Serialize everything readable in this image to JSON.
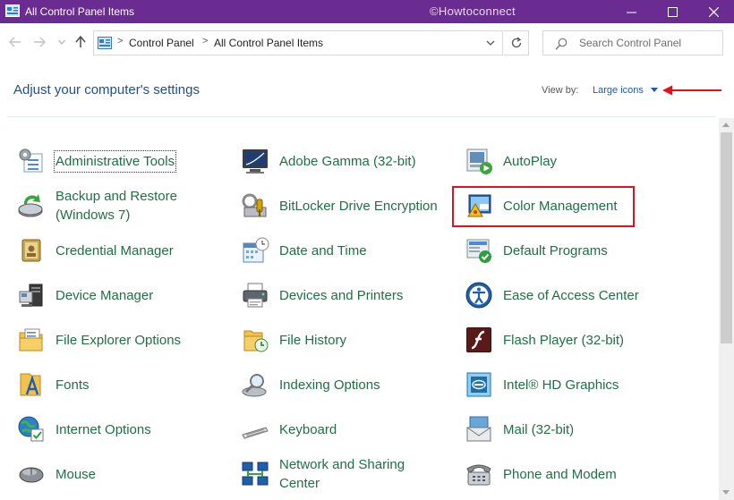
{
  "window": {
    "title": "All Control Panel Items",
    "watermark": "©Howtoconnect",
    "title_color": "#6b2c91"
  },
  "address": {
    "breadcrumbs": [
      "Control Panel",
      "All Control Panel Items"
    ],
    "search_placeholder": "Search Control Panel"
  },
  "header": {
    "heading": "Adjust your computer's settings",
    "view_by_label": "View by:",
    "view_by_value": "Large icons"
  },
  "colors": {
    "link_green": "#1f7044",
    "heading_blue": "#1e4e8c",
    "highlight_red": "#e3101d"
  },
  "items": [
    {
      "label": "Administrative Tools",
      "icon": "administrative-tools-icon"
    },
    {
      "label": "Adobe Gamma (32-bit)",
      "icon": "adobe-gamma-icon"
    },
    {
      "label": "AutoPlay",
      "icon": "autoplay-icon"
    },
    {
      "label": "Backup and Restore\n(Windows 7)",
      "icon": "backup-restore-icon"
    },
    {
      "label": "BitLocker Drive Encryption",
      "icon": "bitlocker-icon"
    },
    {
      "label": "Color Management",
      "icon": "color-management-icon"
    },
    {
      "label": "Credential Manager",
      "icon": "credential-manager-icon"
    },
    {
      "label": "Date and Time",
      "icon": "calendar-clock-icon"
    },
    {
      "label": "Default Programs",
      "icon": "default-programs-icon"
    },
    {
      "label": "Device Manager",
      "icon": "device-manager-icon"
    },
    {
      "label": "Devices and Printers",
      "icon": "printer-icon"
    },
    {
      "label": "Ease of Access Center",
      "icon": "ease-of-access-icon"
    },
    {
      "label": "File Explorer Options",
      "icon": "folder-options-icon"
    },
    {
      "label": "File History",
      "icon": "file-history-icon"
    },
    {
      "label": "Flash Player (32-bit)",
      "icon": "flash-player-icon"
    },
    {
      "label": "Fonts",
      "icon": "fonts-folder-icon"
    },
    {
      "label": "Indexing Options",
      "icon": "indexing-options-icon"
    },
    {
      "label": "Intel® HD Graphics",
      "icon": "intel-graphics-icon"
    },
    {
      "label": "Internet Options",
      "icon": "internet-options-icon"
    },
    {
      "label": "Keyboard",
      "icon": "keyboard-icon"
    },
    {
      "label": "Mail (32-bit)",
      "icon": "mail-icon"
    },
    {
      "label": "Mouse",
      "icon": "mouse-icon"
    },
    {
      "label": "Network and Sharing\nCenter",
      "icon": "network-sharing-icon"
    },
    {
      "label": "Phone and Modem",
      "icon": "phone-modem-icon"
    }
  ]
}
